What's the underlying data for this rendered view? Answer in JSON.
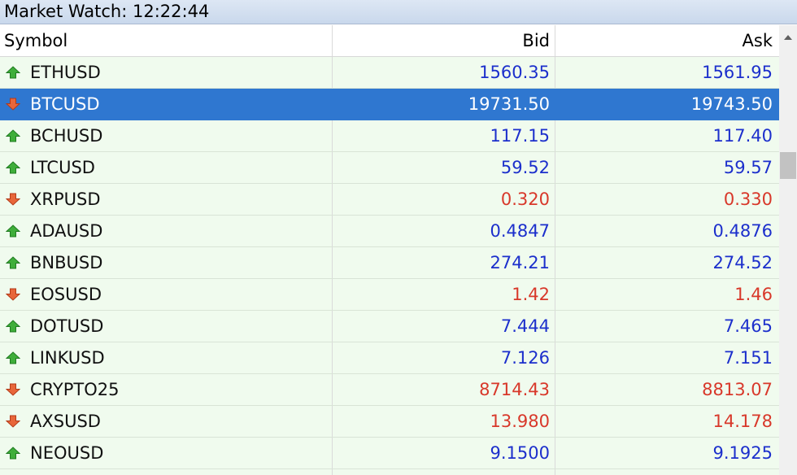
{
  "window": {
    "title": "Market Watch: 12:22:44"
  },
  "columns": {
    "symbol": "Symbol",
    "bid": "Bid",
    "ask": "Ask"
  },
  "colors": {
    "up": "#1c2fcc",
    "down": "#d8382a",
    "row_bg": "#f0fbee",
    "selected_bg": "#2f77d0"
  },
  "rows": [
    {
      "symbol": "ETHUSD",
      "bid": "1560.35",
      "ask": "1561.95",
      "direction": "up",
      "selected": false
    },
    {
      "symbol": "BTCUSD",
      "bid": "19731.50",
      "ask": "19743.50",
      "direction": "down",
      "selected": true
    },
    {
      "symbol": "BCHUSD",
      "bid": "117.15",
      "ask": "117.40",
      "direction": "up",
      "selected": false
    },
    {
      "symbol": "LTCUSD",
      "bid": "59.52",
      "ask": "59.57",
      "direction": "up",
      "selected": false
    },
    {
      "symbol": "XRPUSD",
      "bid": "0.320",
      "ask": "0.330",
      "direction": "down",
      "selected": false
    },
    {
      "symbol": "ADAUSD",
      "bid": "0.4847",
      "ask": "0.4876",
      "direction": "up",
      "selected": false
    },
    {
      "symbol": "BNBUSD",
      "bid": "274.21",
      "ask": "274.52",
      "direction": "up",
      "selected": false
    },
    {
      "symbol": "EOSUSD",
      "bid": "1.42",
      "ask": "1.46",
      "direction": "down",
      "selected": false
    },
    {
      "symbol": "DOTUSD",
      "bid": "7.444",
      "ask": "7.465",
      "direction": "up",
      "selected": false
    },
    {
      "symbol": "LINKUSD",
      "bid": "7.126",
      "ask": "7.151",
      "direction": "up",
      "selected": false
    },
    {
      "symbol": "CRYPTO25",
      "bid": "8714.43",
      "ask": "8813.07",
      "direction": "down",
      "selected": false
    },
    {
      "symbol": "AXSUSD",
      "bid": "13.980",
      "ask": "14.178",
      "direction": "down",
      "selected": false
    },
    {
      "symbol": "NEOUSD",
      "bid": "9.1500",
      "ask": "9.1925",
      "direction": "up",
      "selected": false
    }
  ]
}
